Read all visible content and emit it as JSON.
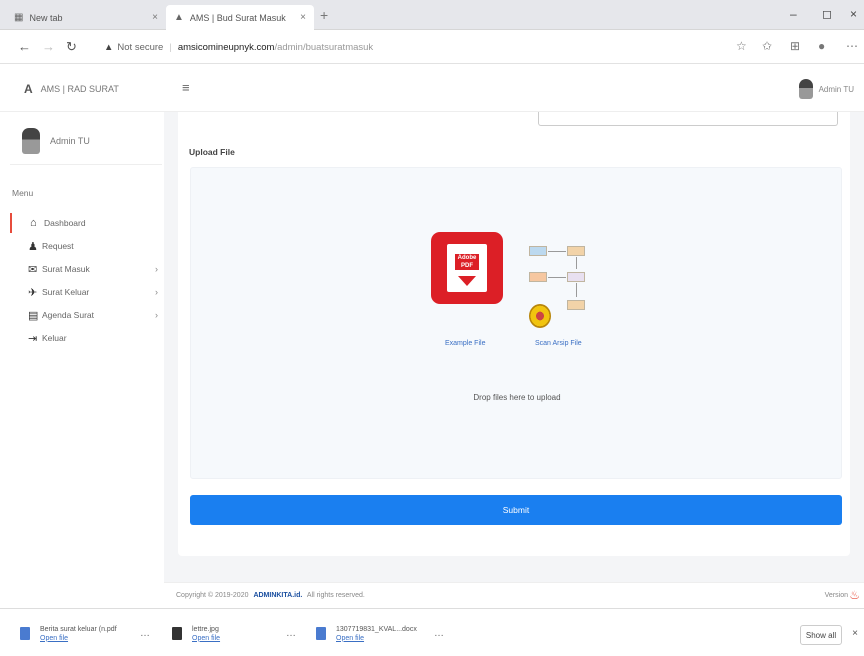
{
  "browser": {
    "tabs": [
      {
        "icon": "▦",
        "label": "New tab",
        "close": "×"
      },
      {
        "icon": "▲",
        "label": "AMS | Bud Surat Masuk",
        "close": "×"
      }
    ],
    "new_tab": "+",
    "window_controls": {
      "minimize": "–",
      "restore": "◻",
      "close": "×"
    },
    "nav": {
      "back": "←",
      "forward": "→",
      "reload": "↻"
    },
    "address": {
      "warning": "▲",
      "not_secure": "Not secure",
      "separator": "|",
      "host": "amsicomineupnyk.com",
      "path": "/admin/buatsuratmasuk"
    },
    "icons": {
      "star": "☆",
      "favorites": "✩",
      "collections": "⊞",
      "profile": "●",
      "menu": "⋯"
    }
  },
  "app": {
    "logo_mark": "A",
    "logo_text": "AMS | RAD SURAT",
    "hamburger": "≡",
    "top_user": "Admin TU"
  },
  "sidebar": {
    "user_name": "Admin TU",
    "menu_heading": "Menu",
    "items": [
      {
        "icon": "⌂",
        "label": "Dashboard",
        "chevron": "",
        "active": true
      },
      {
        "icon": "♟",
        "label": "Request",
        "chevron": ""
      },
      {
        "icon": "✉",
        "label": "Surat Masuk",
        "chevron": "›"
      },
      {
        "icon": "✈",
        "label": "Surat Keluar",
        "chevron": "›"
      },
      {
        "icon": "▤",
        "label": "Agenda Surat",
        "chevron": "›"
      },
      {
        "icon": "⇥",
        "label": "Keluar",
        "chevron": ""
      }
    ]
  },
  "main": {
    "upload_label": "Upload File",
    "pdf_badge": "Adobe PDF",
    "pdf_caption": "Example File",
    "diagram_caption": "Scan Arsip File",
    "drop_text": "Drop files here to upload",
    "submit_label": "Submit"
  },
  "footer": {
    "copyright_prefix": "Copyright © 2019-2020",
    "brand": "ADMINKITA.id.",
    "rights": "All rights reserved.",
    "version": "Version"
  },
  "downloads": {
    "items": [
      {
        "name": "Berita surat keluar (n.pdf",
        "open": "Open file"
      },
      {
        "name": "lettre.jpg",
        "open": "Open file"
      },
      {
        "name": "1307719831_KVAL...docx",
        "open": "Open file"
      }
    ],
    "more": "…",
    "show_all": "Show all",
    "close": "×"
  }
}
